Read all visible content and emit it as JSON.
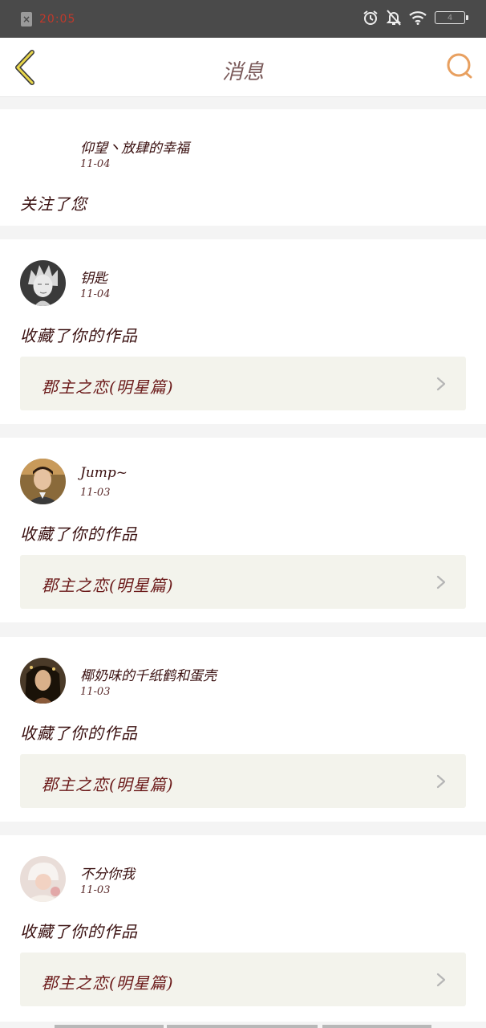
{
  "status_bar": {
    "time": "20:05",
    "battery": "4"
  },
  "nav": {
    "title": "消息"
  },
  "messages": [
    {
      "username": "仰望丶放肆的幸福",
      "date": "11-04",
      "action": "关注了您",
      "work": ""
    },
    {
      "username": "钥匙",
      "date": "11-04",
      "action": "收藏了你的作品",
      "work": "郡主之恋(明星篇)"
    },
    {
      "username": "Jump~",
      "date": "11-03",
      "action": "收藏了你的作品",
      "work": "郡主之恋(明星篇)"
    },
    {
      "username": "椰奶味的千纸鹤和蛋壳",
      "date": "11-03",
      "action": "收藏了你的作品",
      "work": "郡主之恋(明星篇)"
    },
    {
      "username": "不分你我",
      "date": "11-03",
      "action": "收藏了你的作品",
      "work": "郡主之恋(明星篇)"
    }
  ]
}
